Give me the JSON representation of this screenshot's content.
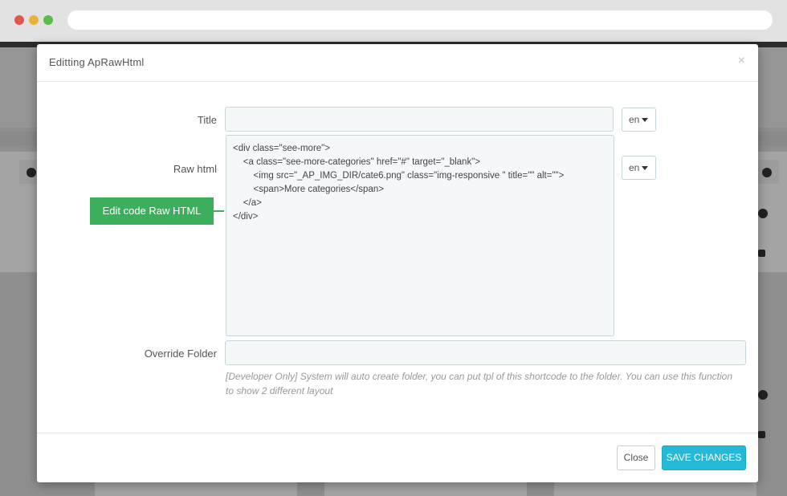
{
  "browser": {
    "address": ""
  },
  "modal": {
    "title": "Editting ApRawHtml",
    "close_glyph": "×"
  },
  "form": {
    "title_label": "Title",
    "title_value": "",
    "title_lang": "en",
    "raw_html_label": "Raw html",
    "raw_html_lang": "en",
    "raw_html_lines": [
      "<div class=\"see-more\">",
      "    <a class=\"see-more-categories\" href=\"#\" target=\"_blank\">",
      "        <img src=\"_AP_IMG_DIR/cate6.png\" class=\"img-responsive \" title=\"\" alt=\"\">",
      "        <span>More categories</span>",
      "    </a>",
      "</div>"
    ],
    "override_folder_label": "Override Folder",
    "override_folder_value": "",
    "override_folder_help": "[Developer Only] System will auto create folder, you can put tpl of this shortcode to the folder. You can use this function to show 2 different layout"
  },
  "callout": {
    "text": "Edit code Raw HTML",
    "color": "#3caf5c"
  },
  "footer": {
    "close_label": "Close",
    "save_label": "SAVE CHANGES",
    "save_color": "#25b9d7"
  },
  "icons": {
    "window_close": "red-dot-icon",
    "window_minimize": "yellow-dot-icon",
    "window_maximize": "green-dot-icon",
    "dropdown_caret": "caret-down-icon"
  }
}
